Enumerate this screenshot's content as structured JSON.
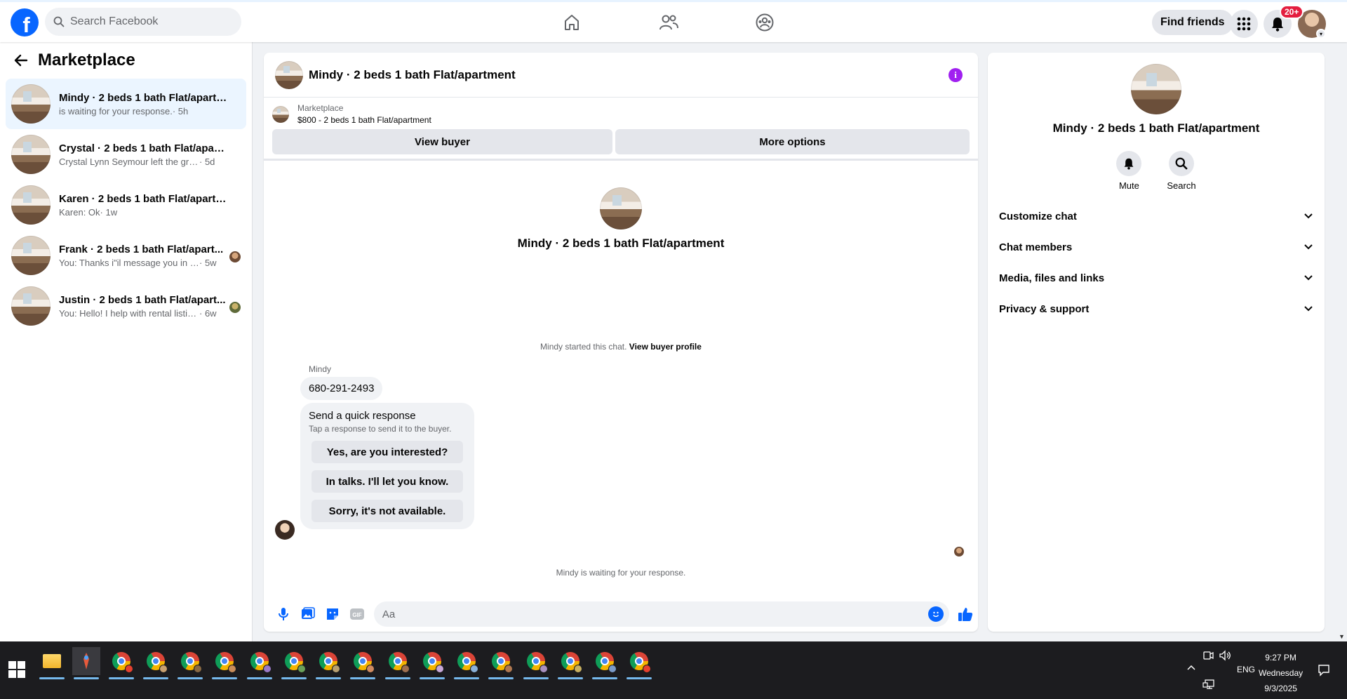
{
  "topbar": {
    "logo_letter": "f",
    "search_placeholder": "Search Facebook",
    "find_friends_label": "Find friends",
    "notification_badge": "20+",
    "nav_icons": [
      "home-icon",
      "friends-icon",
      "groups-icon"
    ],
    "brand_color": "#0866ff"
  },
  "left": {
    "title": "Marketplace",
    "conversations": [
      {
        "title": "Mindy · 2 beds 1 bath Flat/apartm...",
        "snippet": "is waiting for your response.",
        "time": " · 5h",
        "active": true
      },
      {
        "title": "Crystal · 2 beds 1 bath Flat/apartm...",
        "snippet": "Crystal Lynn Seymour left the group.",
        "time": " · 5d",
        "active": false
      },
      {
        "title": "Karen · 2 beds 1 bath Flat/apartment",
        "snippet": "Karen: Ok",
        "time": " · 1w",
        "active": false
      },
      {
        "title": "Frank · 2 beds 1 bath Flat/apart...",
        "snippet": "You: Thanks i\"il message you in a ...",
        "time": " · 5w",
        "active": false
      },
      {
        "title": "Justin · 2 beds 1 bath Flat/apart...",
        "snippet": "You: Hello! I help with rental listing...",
        "time": " · 6w",
        "active": false
      }
    ]
  },
  "chat": {
    "header_title": "Mindy · 2 beds 1 bath Flat/apartment",
    "listing_label": "Marketplace",
    "listing_price": "$800 - 2 beds 1 bath Flat/apartment",
    "view_buyer_label": "View buyer",
    "more_options_label": "More options",
    "intro_name": "Mindy · 2 beds 1 bath Flat/apartment",
    "started_text": "Mindy started this chat.",
    "view_buyer_profile_label": "View buyer profile",
    "sender_name": "Mindy",
    "message": "680-291-2493",
    "quick_title": "Send a quick response",
    "quick_subtitle": "Tap a response to send it to the buyer.",
    "quick_responses": [
      "Yes, are you interested?",
      "In talks. I'll let you know.",
      "Sorry, it's not available."
    ],
    "waiting_text": "Mindy is waiting for your response.",
    "composer_placeholder": "Aa",
    "accent_color": "#0866ff",
    "info_color": "#a020f0"
  },
  "right": {
    "name": "Mindy · 2 beds 1 bath Flat/apartment",
    "mute_label": "Mute",
    "search_label": "Search",
    "sections": [
      "Customize chat",
      "Chat members",
      "Media, files and links",
      "Privacy & support"
    ]
  },
  "taskbar": {
    "language": "ENG",
    "time": "9:27 PM",
    "day": "Wednesday",
    "date": "9/3/2025"
  }
}
